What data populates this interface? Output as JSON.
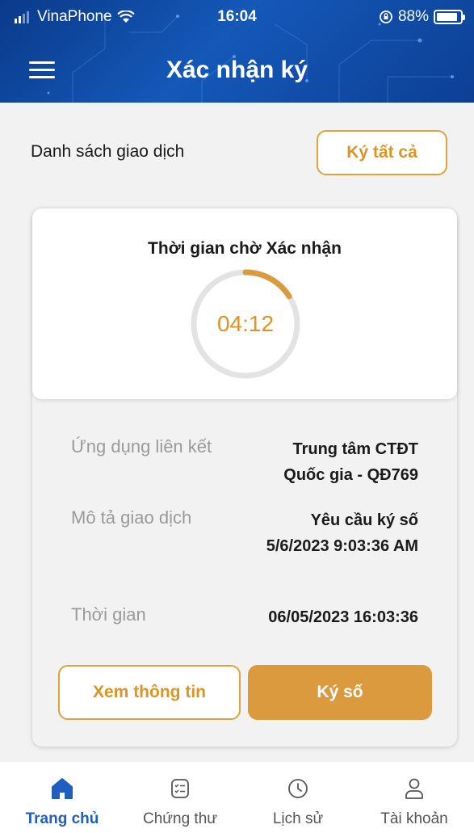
{
  "status_bar": {
    "carrier": "VinaPhone",
    "time": "16:04",
    "battery": "88%",
    "battery_level": 0.88
  },
  "header": {
    "title": "Xác nhận ký",
    "menu_icon": "hamburger-menu-icon"
  },
  "list": {
    "title": "Danh sách giao dịch",
    "sign_all_label": "Ký tất cả"
  },
  "card": {
    "timer_title": "Thời gian chờ Xác nhận",
    "timer_value": "04:12",
    "timer_progress": 0.16,
    "rows": [
      {
        "label": "Ứng dụng liên kết",
        "value": "Trung tâm CTĐT Quốc gia - QĐ769"
      },
      {
        "label": "Mô tả giao dịch",
        "value": "Yêu cầu ký số 5/6/2023 9:03:36 AM"
      },
      {
        "label": "Thời gian",
        "value": "06/05/2023 16:03:36"
      }
    ],
    "view_button": "Xem thông tin",
    "sign_button": "Ký số"
  },
  "colors": {
    "accent": "#dc9427",
    "header_blue": "#1458b8",
    "active_nav": "#1f5fbf"
  },
  "bottom_nav": {
    "items": [
      {
        "label": "Trang chủ",
        "icon": "home-icon",
        "active": true
      },
      {
        "label": "Chứng thư",
        "icon": "certificate-list-icon",
        "active": false
      },
      {
        "label": "Lịch sử",
        "icon": "clock-icon",
        "active": false
      },
      {
        "label": "Tài khoản",
        "icon": "user-icon",
        "active": false
      }
    ]
  }
}
